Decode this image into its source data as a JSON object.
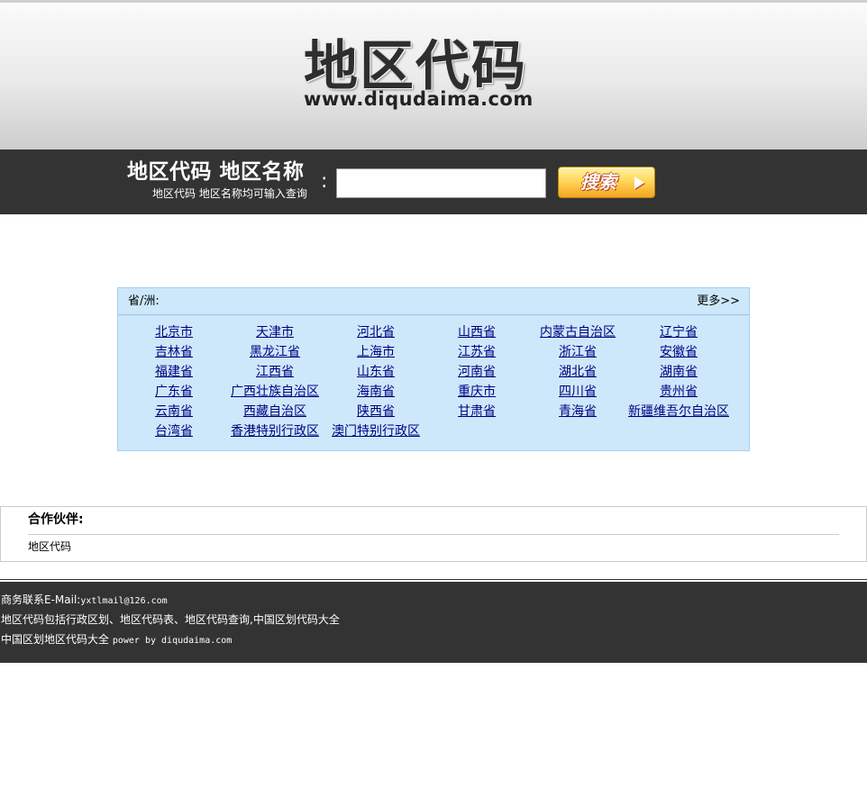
{
  "header": {
    "logo_title": "地区代码",
    "logo_url": "www.diqudaima.com"
  },
  "search": {
    "title": "地区代码 地区名称",
    "hint": "地区代码 地区名称均可输入查询",
    "colon": ":",
    "input_value": "",
    "button_label": "搜索"
  },
  "regions": {
    "header_label": "省/洲:",
    "more_label": "更多>>",
    "items": [
      "北京市",
      "天津市",
      "河北省",
      "山西省",
      "内蒙古自治区",
      "辽宁省",
      "吉林省",
      "黑龙江省",
      "上海市",
      "江苏省",
      "浙江省",
      "安徽省",
      "福建省",
      "江西省",
      "山东省",
      "河南省",
      "湖北省",
      "湖南省",
      "广东省",
      "广西壮族自治区",
      "海南省",
      "重庆市",
      "四川省",
      "贵州省",
      "云南省",
      "西藏自治区",
      "陕西省",
      "甘肃省",
      "青海省",
      "新疆维吾尔自治区",
      "台湾省",
      "香港特别行政区",
      "澳门特别行政区"
    ]
  },
  "partners": {
    "title": "合作伙伴:",
    "links": [
      "地区代码"
    ]
  },
  "footer": {
    "email_label": "商务联系E-Mail:",
    "email": "yxtlmail@126.com",
    "description": "地区代码包括行政区划、地区代码表、地区代码查询,中国区划代码大全",
    "credit_prefix": "中国区划地区代码大全",
    "credit_suffix": "power by diqudaima.com"
  }
}
